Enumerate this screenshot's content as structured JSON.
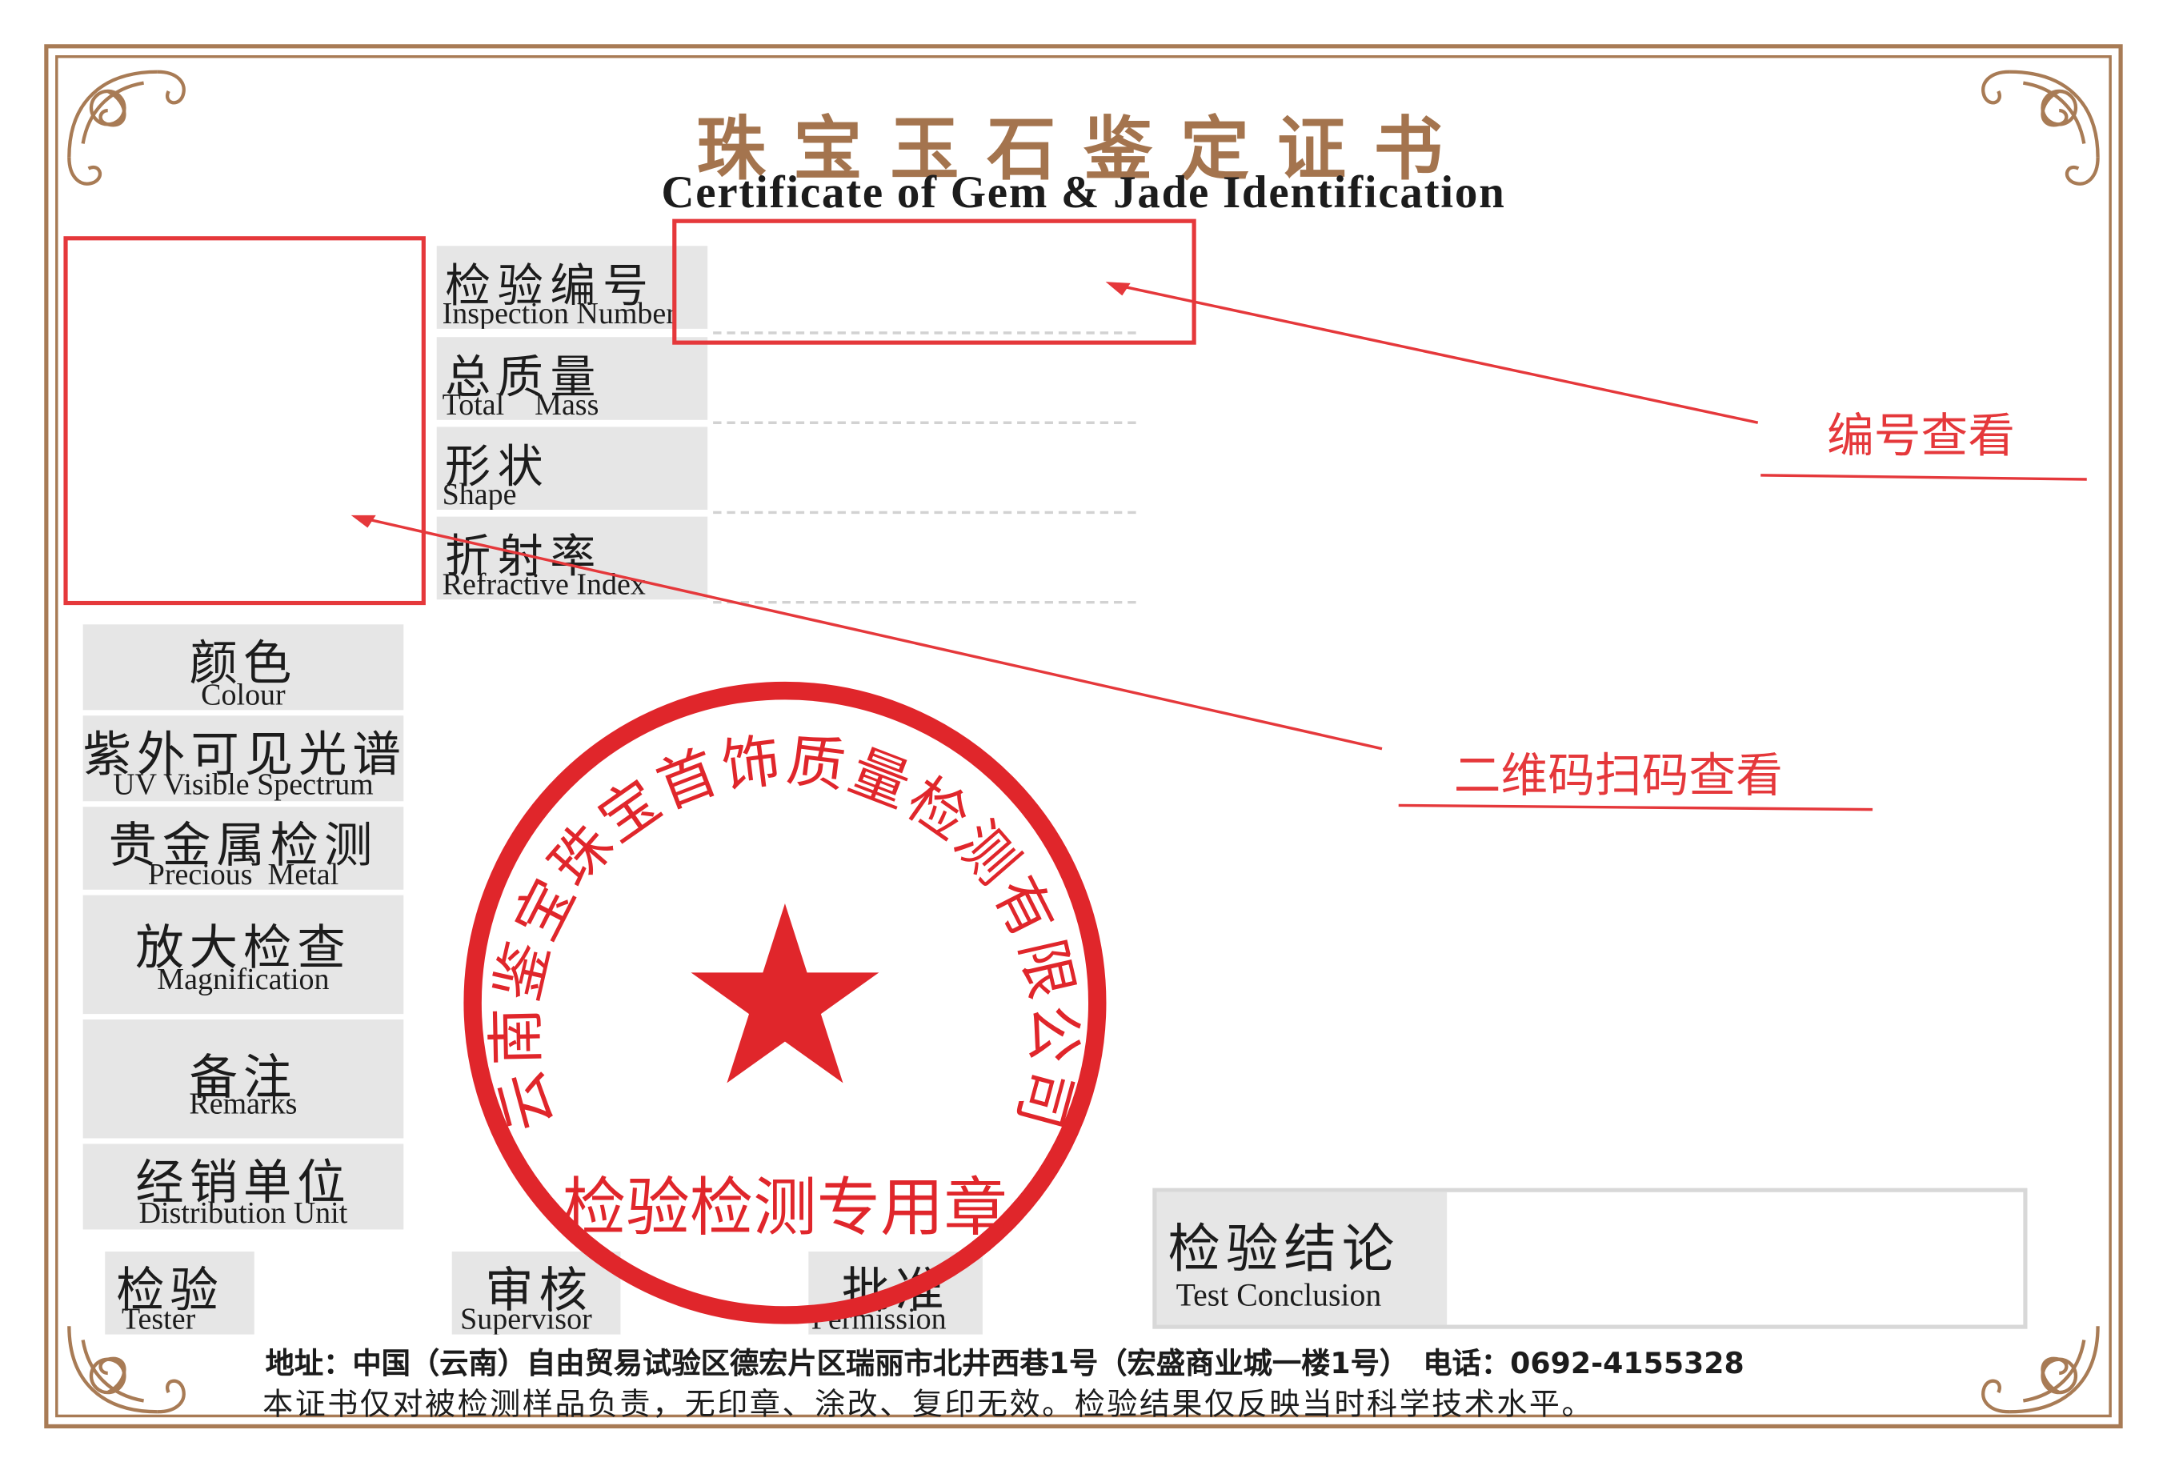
{
  "title": {
    "cn": "珠宝玉石鉴定证书",
    "en": "Certificate of Gem & Jade Identification"
  },
  "fields": [
    {
      "cn": "检验编号",
      "en": "Inspection Number"
    },
    {
      "cn": "总质量",
      "en": "Total    Mass"
    },
    {
      "cn": "形状",
      "en": "Shape"
    },
    {
      "cn": "折射率",
      "en": "Refractive Index"
    }
  ],
  "side_fields": [
    {
      "cn": "颜色",
      "en": "Colour"
    },
    {
      "cn": "紫外可见光谱",
      "en": "UV Visible Spectrum"
    },
    {
      "cn": "贵金属检测",
      "en": "Precious  Metal"
    },
    {
      "cn": "放大检查",
      "en": "Magnification"
    },
    {
      "cn": "备注",
      "en": "Remarks"
    },
    {
      "cn": "经销单位",
      "en": "Distribution Unit"
    }
  ],
  "signatures": [
    {
      "cn": "检验",
      "en": "Tester"
    },
    {
      "cn": "审核",
      "en": "Supervisor"
    },
    {
      "cn": "批准",
      "en": "Permission"
    }
  ],
  "conclusion": {
    "cn": "检验结论",
    "en": "Test Conclusion"
  },
  "seal": {
    "ring_text": "云南鉴宝珠宝首饰质量检测有限公司",
    "bottom_text": "检验检测专用章",
    "color": "#e0262b"
  },
  "annotations": {
    "number_view": "编号查看",
    "qr_view": "二维码扫码查看",
    "color": "#e5383b"
  },
  "footer": {
    "address": "地址：中国（云南）自由贸易试验区德宏片区瑞丽市北井西巷1号（宏盛商业城一楼1号）　电话：0692-4155328",
    "note": "本证书仅对被检测样品负责，无印章、涂改、复印无效。检验结果仅反映当时科学技术水平。"
  },
  "colors": {
    "frame": "#a87b55",
    "title_cn": "#a4744e",
    "label_bg": "#e6e6e6"
  }
}
